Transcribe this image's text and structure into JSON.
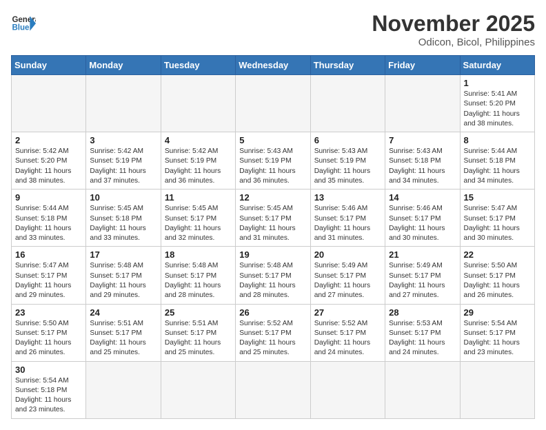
{
  "header": {
    "logo_general": "General",
    "logo_blue": "Blue",
    "month_title": "November 2025",
    "location": "Odicon, Bicol, Philippines"
  },
  "days_of_week": [
    "Sunday",
    "Monday",
    "Tuesday",
    "Wednesday",
    "Thursday",
    "Friday",
    "Saturday"
  ],
  "weeks": [
    [
      {
        "day": "",
        "info": ""
      },
      {
        "day": "",
        "info": ""
      },
      {
        "day": "",
        "info": ""
      },
      {
        "day": "",
        "info": ""
      },
      {
        "day": "",
        "info": ""
      },
      {
        "day": "",
        "info": ""
      },
      {
        "day": "1",
        "info": "Sunrise: 5:41 AM\nSunset: 5:20 PM\nDaylight: 11 hours and 38 minutes."
      }
    ],
    [
      {
        "day": "2",
        "info": "Sunrise: 5:42 AM\nSunset: 5:20 PM\nDaylight: 11 hours and 38 minutes."
      },
      {
        "day": "3",
        "info": "Sunrise: 5:42 AM\nSunset: 5:19 PM\nDaylight: 11 hours and 37 minutes."
      },
      {
        "day": "4",
        "info": "Sunrise: 5:42 AM\nSunset: 5:19 PM\nDaylight: 11 hours and 36 minutes."
      },
      {
        "day": "5",
        "info": "Sunrise: 5:43 AM\nSunset: 5:19 PM\nDaylight: 11 hours and 36 minutes."
      },
      {
        "day": "6",
        "info": "Sunrise: 5:43 AM\nSunset: 5:19 PM\nDaylight: 11 hours and 35 minutes."
      },
      {
        "day": "7",
        "info": "Sunrise: 5:43 AM\nSunset: 5:18 PM\nDaylight: 11 hours and 34 minutes."
      },
      {
        "day": "8",
        "info": "Sunrise: 5:44 AM\nSunset: 5:18 PM\nDaylight: 11 hours and 34 minutes."
      }
    ],
    [
      {
        "day": "9",
        "info": "Sunrise: 5:44 AM\nSunset: 5:18 PM\nDaylight: 11 hours and 33 minutes."
      },
      {
        "day": "10",
        "info": "Sunrise: 5:45 AM\nSunset: 5:18 PM\nDaylight: 11 hours and 33 minutes."
      },
      {
        "day": "11",
        "info": "Sunrise: 5:45 AM\nSunset: 5:17 PM\nDaylight: 11 hours and 32 minutes."
      },
      {
        "day": "12",
        "info": "Sunrise: 5:45 AM\nSunset: 5:17 PM\nDaylight: 11 hours and 31 minutes."
      },
      {
        "day": "13",
        "info": "Sunrise: 5:46 AM\nSunset: 5:17 PM\nDaylight: 11 hours and 31 minutes."
      },
      {
        "day": "14",
        "info": "Sunrise: 5:46 AM\nSunset: 5:17 PM\nDaylight: 11 hours and 30 minutes."
      },
      {
        "day": "15",
        "info": "Sunrise: 5:47 AM\nSunset: 5:17 PM\nDaylight: 11 hours and 30 minutes."
      }
    ],
    [
      {
        "day": "16",
        "info": "Sunrise: 5:47 AM\nSunset: 5:17 PM\nDaylight: 11 hours and 29 minutes."
      },
      {
        "day": "17",
        "info": "Sunrise: 5:48 AM\nSunset: 5:17 PM\nDaylight: 11 hours and 29 minutes."
      },
      {
        "day": "18",
        "info": "Sunrise: 5:48 AM\nSunset: 5:17 PM\nDaylight: 11 hours and 28 minutes."
      },
      {
        "day": "19",
        "info": "Sunrise: 5:48 AM\nSunset: 5:17 PM\nDaylight: 11 hours and 28 minutes."
      },
      {
        "day": "20",
        "info": "Sunrise: 5:49 AM\nSunset: 5:17 PM\nDaylight: 11 hours and 27 minutes."
      },
      {
        "day": "21",
        "info": "Sunrise: 5:49 AM\nSunset: 5:17 PM\nDaylight: 11 hours and 27 minutes."
      },
      {
        "day": "22",
        "info": "Sunrise: 5:50 AM\nSunset: 5:17 PM\nDaylight: 11 hours and 26 minutes."
      }
    ],
    [
      {
        "day": "23",
        "info": "Sunrise: 5:50 AM\nSunset: 5:17 PM\nDaylight: 11 hours and 26 minutes."
      },
      {
        "day": "24",
        "info": "Sunrise: 5:51 AM\nSunset: 5:17 PM\nDaylight: 11 hours and 25 minutes."
      },
      {
        "day": "25",
        "info": "Sunrise: 5:51 AM\nSunset: 5:17 PM\nDaylight: 11 hours and 25 minutes."
      },
      {
        "day": "26",
        "info": "Sunrise: 5:52 AM\nSunset: 5:17 PM\nDaylight: 11 hours and 25 minutes."
      },
      {
        "day": "27",
        "info": "Sunrise: 5:52 AM\nSunset: 5:17 PM\nDaylight: 11 hours and 24 minutes."
      },
      {
        "day": "28",
        "info": "Sunrise: 5:53 AM\nSunset: 5:17 PM\nDaylight: 11 hours and 24 minutes."
      },
      {
        "day": "29",
        "info": "Sunrise: 5:54 AM\nSunset: 5:17 PM\nDaylight: 11 hours and 23 minutes."
      }
    ],
    [
      {
        "day": "30",
        "info": "Sunrise: 5:54 AM\nSunset: 5:18 PM\nDaylight: 11 hours and 23 minutes."
      },
      {
        "day": "",
        "info": ""
      },
      {
        "day": "",
        "info": ""
      },
      {
        "day": "",
        "info": ""
      },
      {
        "day": "",
        "info": ""
      },
      {
        "day": "",
        "info": ""
      },
      {
        "day": "",
        "info": ""
      }
    ]
  ]
}
